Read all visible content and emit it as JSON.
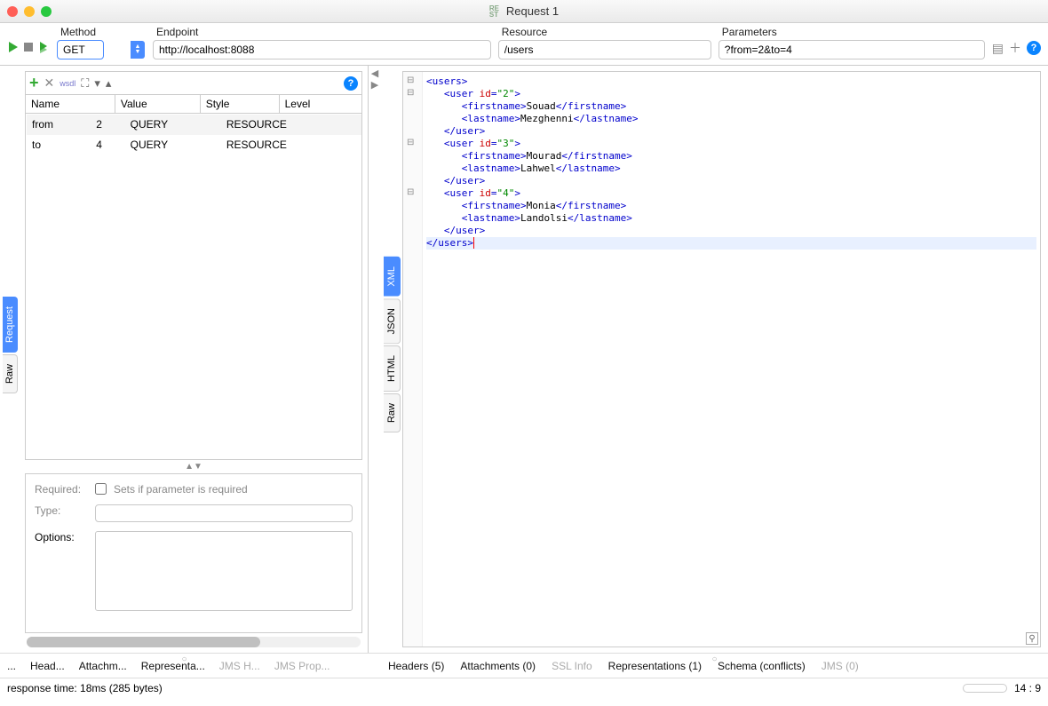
{
  "window": {
    "title": "Request 1",
    "rest_icon": "RE\nST"
  },
  "toolbar": {
    "method_label": "Method",
    "endpoint_label": "Endpoint",
    "resource_label": "Resource",
    "parameters_label": "Parameters",
    "method_value": "GET",
    "endpoint_value": "http://localhost:8088",
    "resource_value": "/users",
    "parameters_value": "?from=2&to=4"
  },
  "left": {
    "vtabs": [
      "Request",
      "Raw"
    ],
    "active_vtab": 0,
    "columns": [
      "Name",
      "Value",
      "Style",
      "Level"
    ],
    "rows": [
      {
        "name": "from",
        "value": "2",
        "style": "QUERY",
        "level": "RESOURCE"
      },
      {
        "name": "to",
        "value": "4",
        "style": "QUERY",
        "level": "RESOURCE"
      }
    ],
    "props": {
      "required_label": "Required:",
      "required_hint": "Sets if parameter is required",
      "type_label": "Type:",
      "options_label": "Options:"
    }
  },
  "right": {
    "vtabs": [
      "XML",
      "JSON",
      "HTML",
      "Raw"
    ],
    "active_vtab": 0,
    "xml_lines": [
      {
        "indent": 0,
        "type": "open",
        "tag": "users",
        "fold": true
      },
      {
        "indent": 1,
        "type": "open",
        "tag": "user",
        "attr": "id",
        "val": "2",
        "fold": true
      },
      {
        "indent": 2,
        "type": "leaf",
        "tag": "firstname",
        "text": "Souad"
      },
      {
        "indent": 2,
        "type": "leaf",
        "tag": "lastname",
        "text": "Mezghenni"
      },
      {
        "indent": 1,
        "type": "close",
        "tag": "user"
      },
      {
        "indent": 1,
        "type": "open",
        "tag": "user",
        "attr": "id",
        "val": "3",
        "fold": true
      },
      {
        "indent": 2,
        "type": "leaf",
        "tag": "firstname",
        "text": "Mourad"
      },
      {
        "indent": 2,
        "type": "leaf",
        "tag": "lastname",
        "text": "Lahwel"
      },
      {
        "indent": 1,
        "type": "close",
        "tag": "user"
      },
      {
        "indent": 1,
        "type": "open",
        "tag": "user",
        "attr": "id",
        "val": "4",
        "fold": true
      },
      {
        "indent": 2,
        "type": "leaf",
        "tag": "firstname",
        "text": "Monia"
      },
      {
        "indent": 2,
        "type": "leaf",
        "tag": "lastname",
        "text": "Landolsi"
      },
      {
        "indent": 1,
        "type": "close",
        "tag": "user"
      },
      {
        "indent": 0,
        "type": "close",
        "tag": "users",
        "highlight": true,
        "cursor": true
      }
    ]
  },
  "bottom": {
    "left_tabs": [
      "...",
      "Head...",
      "Attachm...",
      "Representa...",
      "JMS H...",
      "JMS Prop..."
    ],
    "left_dim": [
      false,
      false,
      false,
      false,
      true,
      true
    ],
    "right_tabs": [
      "Headers (5)",
      "Attachments (0)",
      "SSL Info",
      "Representations (1)",
      "Schema (conflicts)",
      "JMS (0)"
    ],
    "right_dim": [
      false,
      false,
      true,
      false,
      false,
      true
    ]
  },
  "status": {
    "text": "response time: 18ms (285 bytes)",
    "cursor": "14 : 9"
  }
}
